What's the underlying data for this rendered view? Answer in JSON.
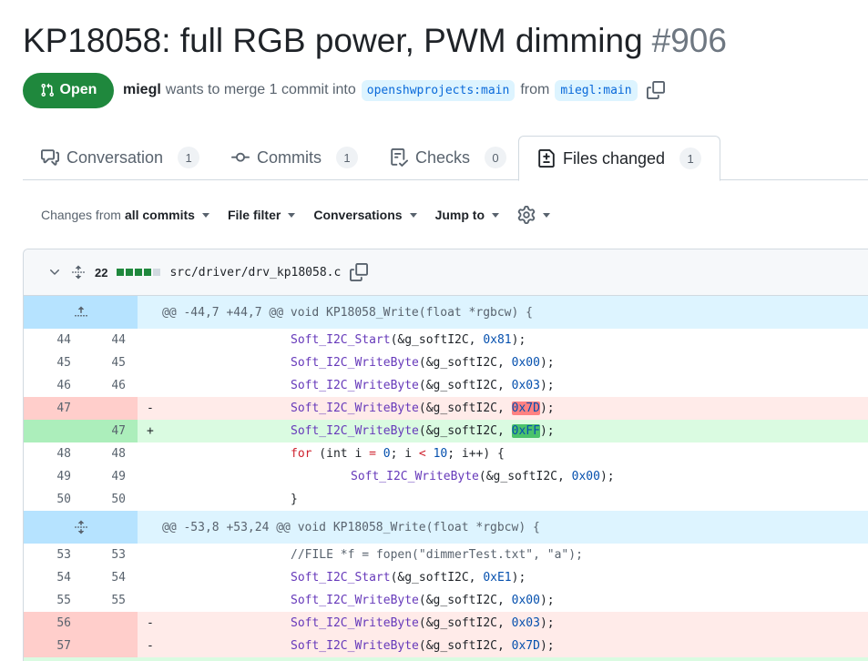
{
  "pr": {
    "title": "KP18058: full RGB power, PWM dimming",
    "number": "#906",
    "state": "Open",
    "author": "miegl",
    "merge_text": "wants to merge 1 commit into",
    "base_branch": "openshwprojects:main",
    "from_text": "from",
    "head_branch": "miegl:main"
  },
  "tabs": [
    {
      "label": "Conversation",
      "count": "1"
    },
    {
      "label": "Commits",
      "count": "1"
    },
    {
      "label": "Checks",
      "count": "0"
    },
    {
      "label": "Files changed",
      "count": "1"
    }
  ],
  "toolbar": {
    "changes_from_prefix": "Changes from",
    "changes_from_value": "all commits",
    "file_filter": "File filter",
    "conversations": "Conversations",
    "jump_to": "Jump to"
  },
  "file": {
    "changes": "22",
    "path": "src/driver/drv_kp18058.c"
  },
  "hunks": [
    "@@ -44,7 +44,7 @@ void KP18058_Write(float *rgbcw) {",
    "@@ -53,8 +53,24 @@ void KP18058_Write(float *rgbcw) {"
  ],
  "lines": [
    {
      "old": "44",
      "new": "44",
      "sign": "",
      "fn": "Soft_I2C_Start",
      "rest": "(&g_softI2C, ",
      "val": "0x81",
      "end": ");"
    },
    {
      "old": "45",
      "new": "45",
      "sign": "",
      "fn": "Soft_I2C_WriteByte",
      "rest": "(&g_softI2C, ",
      "val": "0x00",
      "end": ");"
    },
    {
      "old": "46",
      "new": "46",
      "sign": "",
      "fn": "Soft_I2C_WriteByte",
      "rest": "(&g_softI2C, ",
      "val": "0x03",
      "end": ");"
    },
    {
      "old": "47",
      "new": "",
      "sign": "-",
      "fn": "Soft_I2C_WriteByte",
      "rest": "(&g_softI2C, ",
      "val": "0x7D",
      "end": ");"
    },
    {
      "old": "",
      "new": "47",
      "sign": "+",
      "fn": "Soft_I2C_WriteByte",
      "rest": "(&g_softI2C, ",
      "val": "0xFF",
      "end": ");"
    },
    {
      "old": "48",
      "new": "48",
      "for_kw": "for",
      "for_a": " (int i ",
      "for_eq": "=",
      "for_zero": "0",
      "for_b": "; i ",
      "for_lt": "<",
      "for_ten": "10",
      "for_c": "; i++) {"
    },
    {
      "old": "49",
      "new": "49",
      "sign": "",
      "fn": "Soft_I2C_WriteByte",
      "rest": "(&g_softI2C, ",
      "val": "0x00",
      "end": ");"
    },
    {
      "old": "50",
      "new": "50",
      "brace": "}"
    },
    {
      "old": "53",
      "new": "53",
      "comment": "//FILE *f = fopen(\"dimmerTest.txt\", \"a\");"
    },
    {
      "old": "54",
      "new": "54",
      "sign": "",
      "fn": "Soft_I2C_Start",
      "rest": "(&g_softI2C, ",
      "val": "0xE1",
      "end": ");"
    },
    {
      "old": "55",
      "new": "55",
      "sign": "",
      "fn": "Soft_I2C_WriteByte",
      "rest": "(&g_softI2C, ",
      "val": "0x00",
      "end": ");"
    },
    {
      "old": "56",
      "new": "",
      "sign": "-",
      "fn": "Soft_I2C_WriteByte",
      "rest": "(&g_softI2C, ",
      "val": "0x03",
      "end": ");"
    },
    {
      "old": "57",
      "new": "",
      "sign": "-",
      "fn": "Soft_I2C_WriteByte",
      "rest": "(&g_softI2C, ",
      "val": "0x7D",
      "end": ");"
    }
  ],
  "colors": {
    "open_green": "#1f883d",
    "deletion_bg": "#ffebe9",
    "addition_bg": "#dafbe1",
    "hunk_bg": "#ddf4ff"
  }
}
